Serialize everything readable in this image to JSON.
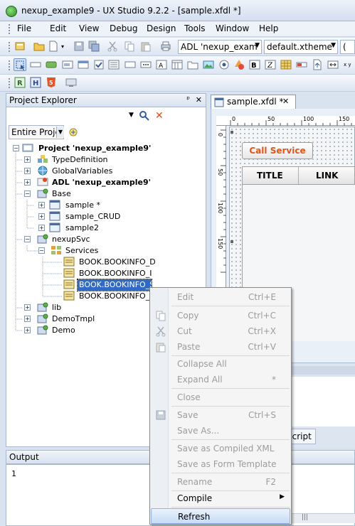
{
  "window": {
    "title": "nexup_example9 - UX Studio 9.2.2 - [sample.xfdl *]"
  },
  "menu": [
    "File",
    "Edit",
    "View",
    "Debug",
    "Design",
    "Tools",
    "Window",
    "Help"
  ],
  "toolbar": {
    "adl_combo": "ADL 'nexup_exam",
    "theme_combo": "default.xtheme",
    "extra_combo": "("
  },
  "project_explorer": {
    "title": "Project Explorer",
    "pin_glyph": "ᵖ",
    "close_glyph": "✕",
    "filter_combo": "Entire Proje",
    "tree": {
      "root": "Project 'nexup_example9'",
      "type_definition": "TypeDefinition",
      "global_variables": "GlobalVariables",
      "adl": "ADL 'nexup_example9'",
      "base": "Base",
      "sample": "sample *",
      "sample_crud": "sample_CRUD",
      "sample2": "sample2",
      "nexup_svc": "nexupSvc",
      "services": "Services",
      "svc1": "BOOK.BOOKINFO_D",
      "svc2": "BOOK.BOOKINFO_I",
      "svc3": "BOOK.BOOKINFO_S",
      "svc4": "BOOK.BOOKINFO_U",
      "lib": "lib",
      "demo_tmpl": "DemoTmpl",
      "demo": "Demo"
    }
  },
  "editor": {
    "tab_label": "sample.xfdl *",
    "tab_close": "✕",
    "ruler_top": [
      "0",
      "50",
      "100",
      "150"
    ],
    "ruler_left": [
      "0",
      "50",
      "100",
      "150"
    ],
    "call_button": "Call Service",
    "grid_headers": [
      "TITLE",
      "LINK"
    ],
    "script_tab": "Script"
  },
  "output": {
    "title": "Output",
    "line1": "1"
  },
  "context_menu": {
    "items": [
      {
        "label": "Edit",
        "shortcut": "Ctrl+E",
        "disabled": true
      },
      {
        "label": "Copy",
        "shortcut": "Ctrl+C",
        "disabled": true
      },
      {
        "label": "Cut",
        "shortcut": "Ctrl+X",
        "disabled": true
      },
      {
        "label": "Paste",
        "shortcut": "Ctrl+V",
        "disabled": true
      },
      {
        "label": "Collapse All",
        "shortcut": "",
        "disabled": true
      },
      {
        "label": "Expand All",
        "shortcut": "*",
        "disabled": true
      },
      {
        "label": "Close",
        "shortcut": "",
        "disabled": true
      },
      {
        "label": "Save",
        "shortcut": "Ctrl+S",
        "disabled": true
      },
      {
        "label": "Save As...",
        "shortcut": "",
        "disabled": true
      },
      {
        "label": "Save as Compiled XML",
        "shortcut": "",
        "disabled": true
      },
      {
        "label": "Save as Form Template",
        "shortcut": "",
        "disabled": true
      },
      {
        "label": "Rename",
        "shortcut": "F2",
        "disabled": true
      },
      {
        "label": "Compile",
        "shortcut": "",
        "disabled": false
      },
      {
        "label": "Refresh",
        "shortcut": "",
        "disabled": false
      }
    ]
  },
  "colors": {
    "accent": "#316ac5",
    "call_button_text": "#e0561b",
    "background": "#d9e3f0"
  }
}
